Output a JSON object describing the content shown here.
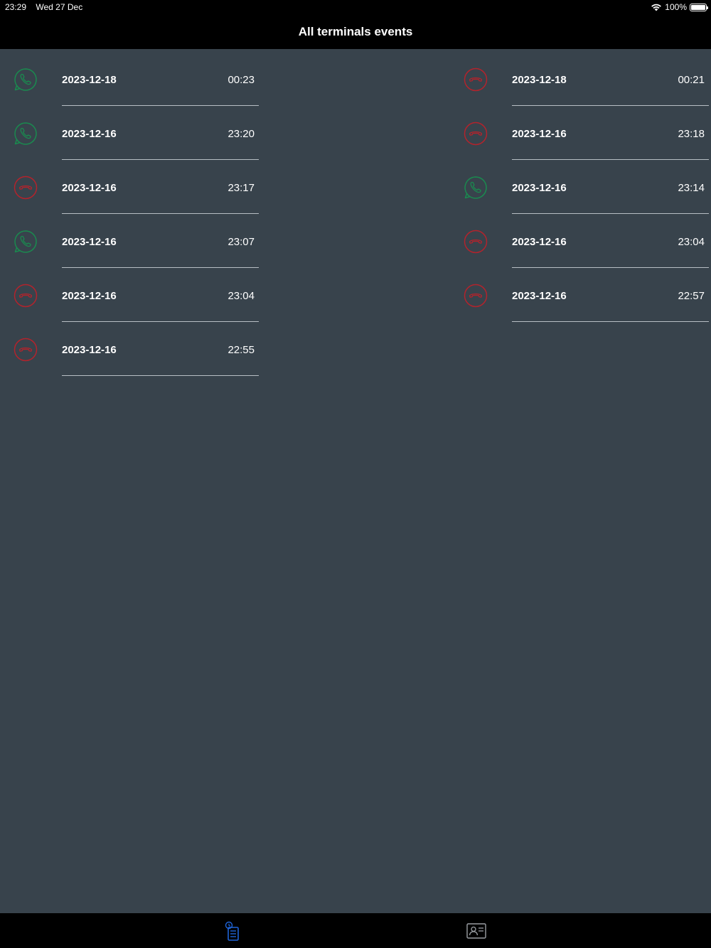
{
  "status_bar": {
    "time": "23:29",
    "date": "Wed 27 Dec",
    "battery": "100%",
    "icons": [
      "wifi-icon",
      "battery-icon"
    ]
  },
  "nav": {
    "title": "All terminals events"
  },
  "colors": {
    "accepted": "#1a8a4f",
    "declined": "#b3232c",
    "tab_active": "#1f64d8",
    "tab_inactive": "#9a9ea3"
  },
  "events_left": [
    {
      "status": "accepted",
      "icon": "phone-accepted-icon",
      "date": "2023-12-18",
      "time": "00:23"
    },
    {
      "status": "accepted",
      "icon": "phone-accepted-icon",
      "date": "2023-12-16",
      "time": "23:20"
    },
    {
      "status": "declined",
      "icon": "phone-hangup-icon",
      "date": "2023-12-16",
      "time": "23:17"
    },
    {
      "status": "accepted",
      "icon": "phone-accepted-icon",
      "date": "2023-12-16",
      "time": "23:07"
    },
    {
      "status": "declined",
      "icon": "phone-hangup-icon",
      "date": "2023-12-16",
      "time": "23:04"
    },
    {
      "status": "declined",
      "icon": "phone-hangup-icon",
      "date": "2023-12-16",
      "time": "22:55"
    }
  ],
  "events_right": [
    {
      "status": "declined",
      "icon": "phone-hangup-icon",
      "date": "2023-12-18",
      "time": "00:21"
    },
    {
      "status": "declined",
      "icon": "phone-hangup-icon",
      "date": "2023-12-16",
      "time": "23:18"
    },
    {
      "status": "accepted",
      "icon": "phone-accepted-icon",
      "date": "2023-12-16",
      "time": "23:14"
    },
    {
      "status": "declined",
      "icon": "phone-hangup-icon",
      "date": "2023-12-16",
      "time": "23:04"
    },
    {
      "status": "declined",
      "icon": "phone-hangup-icon",
      "date": "2023-12-16",
      "time": "22:57"
    }
  ],
  "tabs": [
    {
      "name": "events",
      "icon": "call-log-icon",
      "active": true
    },
    {
      "name": "contacts",
      "icon": "contact-card-icon",
      "active": false
    }
  ]
}
